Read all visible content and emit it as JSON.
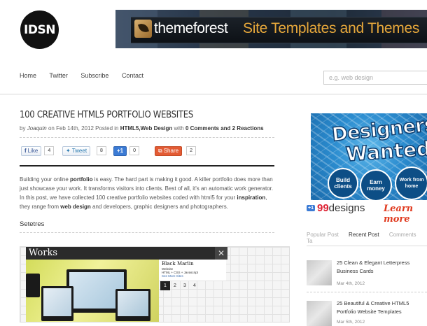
{
  "logo": "IDSN",
  "banner": {
    "brand": "themeforest",
    "tagline": "Site Templates and Themes"
  },
  "nav": [
    "Home",
    "Twitter",
    "Subscribe",
    "Contact"
  ],
  "search": {
    "placeholder": "e.g. web design"
  },
  "post": {
    "title": "100 Creative HTML5 Portfolio Websites",
    "meta": {
      "by": "by",
      "author": "Joaquin",
      "on": "on Feb 14th, 2012 Posted in",
      "categories": "HTML5,Web Design",
      "with": "with",
      "comments": "0 Comments and 2 Reactions"
    },
    "social": {
      "like": "Like",
      "like_count": "4",
      "tweet": "Tweet",
      "tweet_count": "8",
      "plusone": "+1",
      "plusone_count": "0",
      "share": "Share",
      "share_count": "2"
    },
    "body": {
      "p1": "Building your online ",
      "b1": "portfolio",
      "p2": " is easy. The hard part is making it good. A killer portfolio does more than just showcase your work. It transforms visitors into clients. Best of all, it's an automatic work generator. In this post, we have collected 100 creative portfolio websites coded with html5 for your ",
      "b2": "inspiration",
      "p3": ", they range from ",
      "b3": "web design",
      "p4": " and developers, graphic designers and photographers."
    },
    "subheading": "Setetres",
    "screenshot": {
      "heading": "Works",
      "close": "✕",
      "card_title": "Black Marlin",
      "card_line1": "Website",
      "card_line2": "HTML + CSS + Javascript",
      "card_line3": "See More Sites",
      "pages": [
        "1",
        "2",
        "3",
        "4"
      ]
    }
  },
  "sidebar": {
    "ad": {
      "line1": "Designers",
      "line2": "Wanted",
      "badge1": "Build clients",
      "badge2": "Earn money",
      "badge3": "Work from home"
    },
    "brand": {
      "plus": "+1",
      "num": "99",
      "word": "designs"
    },
    "learn": "Learn more",
    "tabs": [
      "Popular Post",
      "Recent Post",
      "Comments",
      "Ta"
    ],
    "posts": [
      {
        "title": "25 Clean & Elegant Letterpress Business Cards",
        "date": "Mar 4th, 2012"
      },
      {
        "title": "25 Beautiful & Creative HTML5 Portfolio Website Templates",
        "date": "Mar 5th, 2012"
      }
    ]
  }
}
